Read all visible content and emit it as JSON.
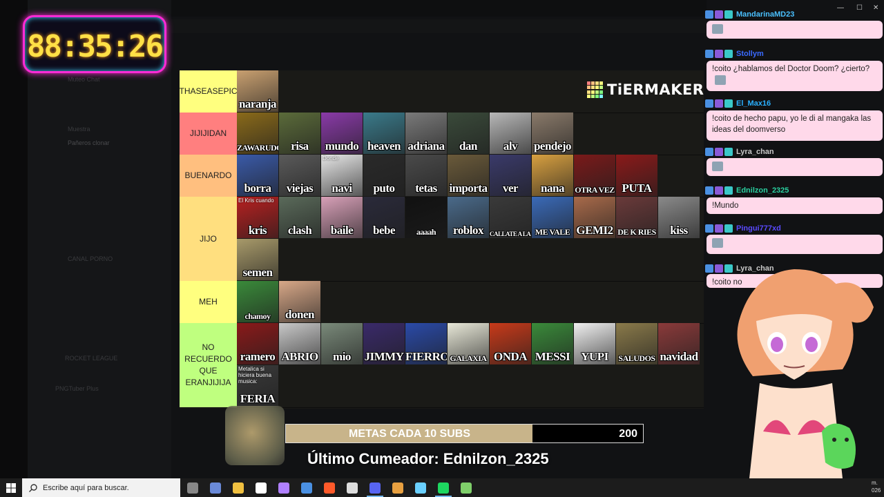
{
  "timer": {
    "display": "88:35:26"
  },
  "background_app": {
    "channels": [
      "Muteo Chat",
      "Muestra",
      "Pañeros clonar",
      "CANAL PORNO",
      "ROCKET LEAGUE",
      "PNGTuber Plus"
    ]
  },
  "tierlist": {
    "logo_text": "TiERMAKER",
    "tiers": [
      {
        "label": "THASEASEPIC",
        "color": "#ffff7f",
        "items": [
          {
            "caption": "naranja",
            "bg": "#c9a070"
          }
        ]
      },
      {
        "label": "JIJIJIDAN",
        "color": "#ff7f7f",
        "items": [
          {
            "caption": "ZAWARUDO",
            "bg": "#8a6a1a",
            "size": "sm"
          },
          {
            "caption": "risa",
            "bg": "#5b6b3a"
          },
          {
            "caption": "mundo",
            "bg": "#8a3aa8"
          },
          {
            "caption": "heaven",
            "bg": "#3a7a8a"
          },
          {
            "caption": "adriana",
            "bg": "#7a7a7a"
          },
          {
            "caption": "dan",
            "bg": "#3a4a3a"
          },
          {
            "caption": "alv",
            "bg": "#b8b8b8"
          },
          {
            "caption": "pendejo",
            "bg": "#8a7a6a"
          }
        ]
      },
      {
        "label": "BUENARDO",
        "color": "#ffbf7f",
        "items": [
          {
            "caption": "borra",
            "bg": "#3a5aa8"
          },
          {
            "caption": "viejas",
            "bg": "#5a5a5a"
          },
          {
            "caption": "navi",
            "bg": "#e8e8e8",
            "top": "Donde"
          },
          {
            "caption": "puto",
            "bg": "#2a2a2a"
          },
          {
            "caption": "tetas",
            "bg": "#4a4a4a"
          },
          {
            "caption": "importa",
            "bg": "#6a5a3a"
          },
          {
            "caption": "ver",
            "bg": "#3a3a6a"
          },
          {
            "caption": "nana",
            "bg": "#d8a040"
          },
          {
            "caption": "OTRA VEZ",
            "bg": "#7a1a1a",
            "size": "sm"
          },
          {
            "caption": "PUTA",
            "bg": "#8a1a1a"
          }
        ]
      },
      {
        "label": "JIJO",
        "color": "#ffdf7f",
        "items": [
          {
            "caption": "kris",
            "bg": "#b82020",
            "top": "El Kris cuando"
          },
          {
            "caption": "clash",
            "bg": "#5a6a5a"
          },
          {
            "caption": "baile",
            "bg": "#d8a0b8"
          },
          {
            "caption": "bebe",
            "bg": "#2a2a3a"
          },
          {
            "caption": "aaaah",
            "bg": "#111111",
            "size": "sm"
          },
          {
            "caption": "roblox",
            "bg": "#4a6a8a"
          },
          {
            "caption": "CALLATE A LA VERGA SAMUEL",
            "bg": "#3a3a3a",
            "size": "xs"
          },
          {
            "caption": "ME VALE",
            "bg": "#3a6ab8",
            "size": "sm"
          },
          {
            "caption": "GEMI2",
            "bg": "#a86a4a"
          },
          {
            "caption": "DE K RIES",
            "bg": "#6a3a3a",
            "size": "sm"
          },
          {
            "caption": "kiss",
            "bg": "#8a8a8a"
          },
          {
            "caption": "semen",
            "bg": "#a89a6a"
          }
        ]
      },
      {
        "label": "MEH",
        "color": "#ffff7f",
        "items": [
          {
            "caption": "chamoy",
            "bg": "#3a8a3a",
            "size": "sm"
          },
          {
            "caption": "donen",
            "bg": "#d8a888"
          }
        ]
      },
      {
        "label": "NO RECUERDO QUE ERANJIJIJA",
        "color": "#bfff7f",
        "items": [
          {
            "caption": "ramero",
            "bg": "#8a1a1a"
          },
          {
            "caption": "ABRIO",
            "bg": "#c8c8c8"
          },
          {
            "caption": "mio",
            "bg": "#7a8a7a"
          },
          {
            "caption": "JIMMY",
            "bg": "#3a2a6a"
          },
          {
            "caption": "FIERRO",
            "bg": "#2a4aa8"
          },
          {
            "caption": "GALAXIA",
            "bg": "#e8e8d8",
            "size": "sm"
          },
          {
            "caption": "ONDA",
            "bg": "#c83a1a"
          },
          {
            "caption": "MESSI",
            "bg": "#3a8a3a"
          },
          {
            "caption": "YUPI",
            "bg": "#f0f0f0"
          },
          {
            "caption": "SALUDOS",
            "bg": "#8a7a4a",
            "size": "sm"
          },
          {
            "caption": "navidad",
            "bg": "#8a3a3a"
          },
          {
            "caption": "FERIA",
            "bg": "#3a3a3a",
            "top": "Metalica si hiciera buena musica:"
          }
        ]
      }
    ]
  },
  "goal": {
    "label": "METAS CADA 10 SUBS",
    "target": "200",
    "progress": 0.69
  },
  "last_cum": "Último Cumeador: Ednilzon_2325",
  "chat": {
    "messages": [
      {
        "user": "MandarinaMD23",
        "color": "#4ac0ff",
        "text": "",
        "emote": true
      },
      {
        "user": "Stollym",
        "color": "#3a6aff",
        "text": "!coito ¿hablamos del Doctor Doom? ¿cierto?",
        "emote": true
      },
      {
        "user": "El_Max16",
        "color": "#2ab0ff",
        "text": "!coito de hecho papu, yo le di al mangaka las ideas del doomverso",
        "emote": false
      },
      {
        "user": "Lyra_chan",
        "color": "#c8c8c8",
        "text": "",
        "emote": true
      },
      {
        "user": "Ednilzon_2325",
        "color": "#2ad0a0",
        "text": "!Mundo",
        "emote": false
      },
      {
        "user": "Pingui777xd",
        "color": "#5a4aff",
        "text": "",
        "emote": true
      },
      {
        "user": "Lyra_chan",
        "color": "#c8c8c8",
        "text": "!coito no",
        "emote": false
      }
    ]
  },
  "taskbar": {
    "search_placeholder": "Escribe aquí para buscar.",
    "apps": [
      "task-view",
      "copilot",
      "explorer",
      "notion",
      "pen",
      "store",
      "brave",
      "obs",
      "discord",
      "player",
      "calculator",
      "spotify",
      "tiermaker"
    ],
    "clock": "m.",
    "date": "026"
  }
}
